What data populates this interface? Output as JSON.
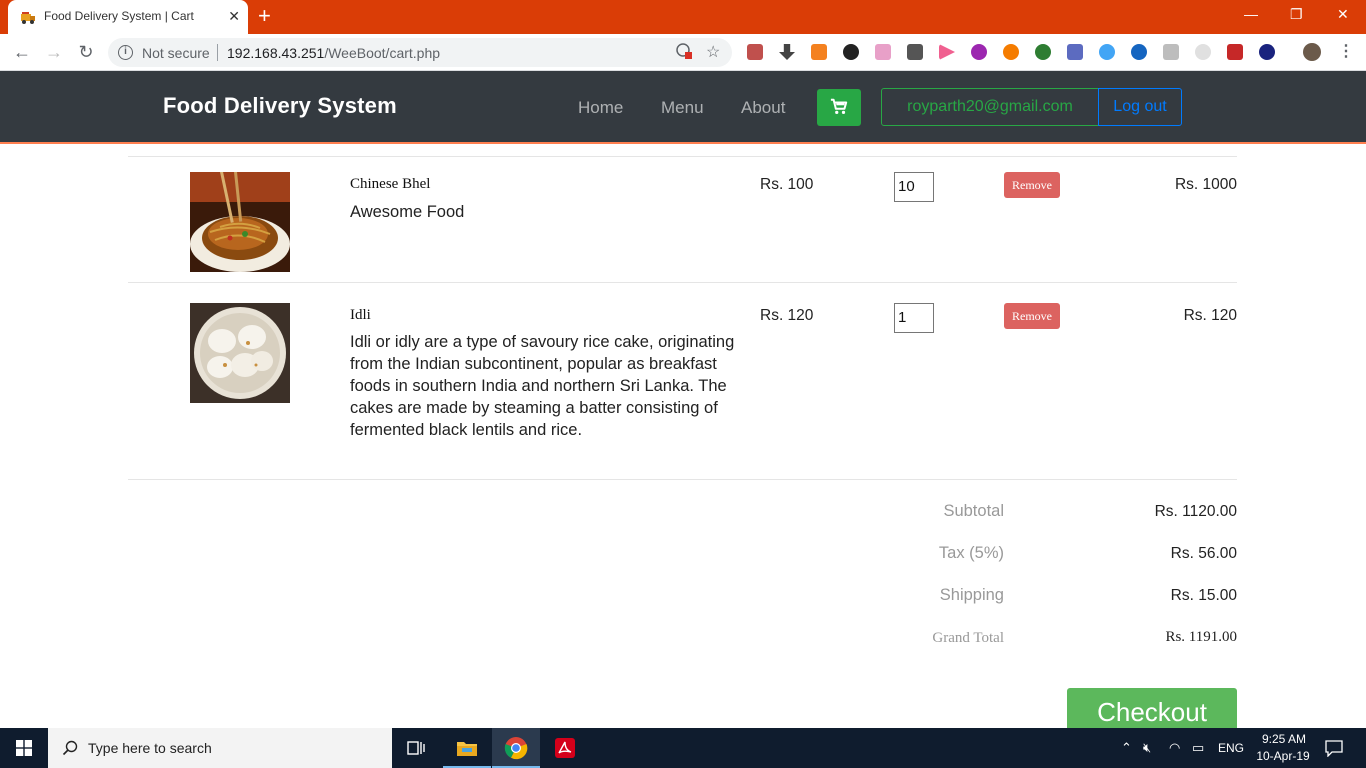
{
  "browser": {
    "tab_title": "Food Delivery System | Cart",
    "not_secure": "Not secure",
    "url_host": "192.168.43.251",
    "url_path": "/WeeBoot/cart.php"
  },
  "navbar": {
    "brand": "Food Delivery System",
    "links": [
      "Home",
      "Menu",
      "About"
    ],
    "email": "royparth20@gmail.com",
    "logout": "Log out"
  },
  "cart": {
    "items": [
      {
        "name": "Chinese Bhel",
        "description": "Awesome Food",
        "price": "Rs. 100",
        "quantity": "10",
        "remove_label": "Remove",
        "total": "Rs. 1000"
      },
      {
        "name": "Idli",
        "description": "Idli or idly are a type of savoury rice cake, originating from the Indian subcontinent, popular as breakfast foods in southern India and northern Sri Lanka. The cakes are made by steaming a batter consisting of fermented black lentils and rice.",
        "price": "Rs. 120",
        "quantity": "1",
        "remove_label": "Remove",
        "total": "Rs. 120"
      }
    ],
    "summary": {
      "subtotal_label": "Subtotal",
      "subtotal": "Rs. 1120.00",
      "tax_label": "Tax (5%)",
      "tax": "Rs. 56.00",
      "shipping_label": "Shipping",
      "shipping": "Rs. 15.00",
      "grand_total_label": "Grand Total",
      "grand_total": "Rs. 1191.00"
    },
    "checkout_label": "Checkout"
  },
  "taskbar": {
    "search_placeholder": "Type here to search",
    "language": "ENG",
    "time": "9:25 AM",
    "date": "10-Apr-19"
  },
  "colors": {
    "titlebar": "#da3d06",
    "navbar": "#343a40",
    "success": "#28a745",
    "primary": "#007bff",
    "danger": "#d9534f"
  }
}
